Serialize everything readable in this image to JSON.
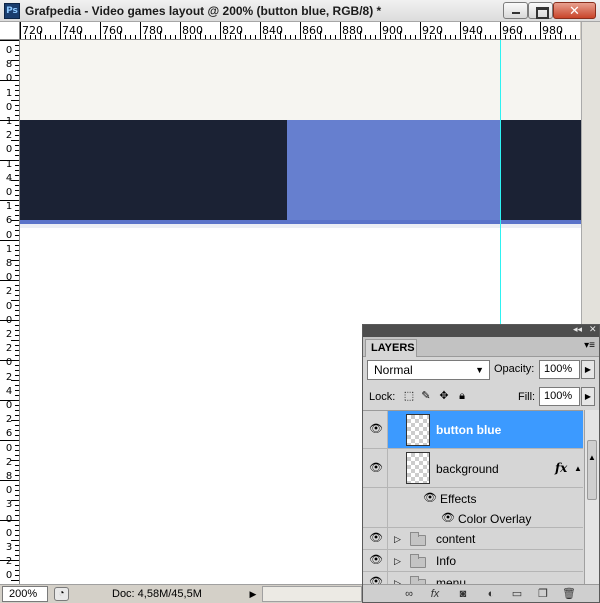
{
  "window": {
    "app_logo": "Ps",
    "title": "Grafpedia - Video games layout @ 200% (button blue, RGB/8) *",
    "close_label": "✕"
  },
  "ruler": {
    "top_labels": [
      "720",
      "740",
      "760",
      "780",
      "800",
      "820",
      "840",
      "860",
      "880",
      "900",
      "920",
      "940",
      "960",
      "980"
    ],
    "left_labels": [
      "0",
      "8",
      "0",
      "1",
      "0",
      "1",
      "2",
      "0",
      "1",
      "4",
      "0",
      "1",
      "6",
      "0",
      "1",
      "8",
      "0",
      "2",
      "0",
      "0",
      "2",
      "2",
      "0",
      "2",
      "4",
      "0",
      "2",
      "6",
      "0",
      "2",
      "8",
      "0",
      "3",
      "0",
      "0",
      "3",
      "2",
      "0"
    ]
  },
  "canvas": {
    "colors": {
      "top": "#f6f5f1",
      "nav": "#1b2234",
      "button": "#667fcf",
      "guide": "#2ef2f2"
    }
  },
  "statusbar": {
    "zoom": "200%",
    "doc_info": "Doc: 4,58M/45,5M"
  },
  "layers_panel": {
    "tab_label": "LAYERS",
    "collapse_glyph": "◂◂",
    "close_glyph": "✕",
    "menu_glyph": "▾≡",
    "blend_mode": "Normal",
    "opacity_label": "Opacity:",
    "opacity_value": "100%",
    "lock_label": "Lock:",
    "fill_label": "Fill:",
    "fill_value": "100%",
    "layers": [
      {
        "name": "button blue",
        "selected": true
      },
      {
        "name": "background",
        "fx": "fx"
      },
      {
        "name": "Effects"
      },
      {
        "name": "Color Overlay"
      },
      {
        "name": "content"
      },
      {
        "name": "Info"
      },
      {
        "name": "menu"
      }
    ],
    "accent": "#3c9aff"
  }
}
